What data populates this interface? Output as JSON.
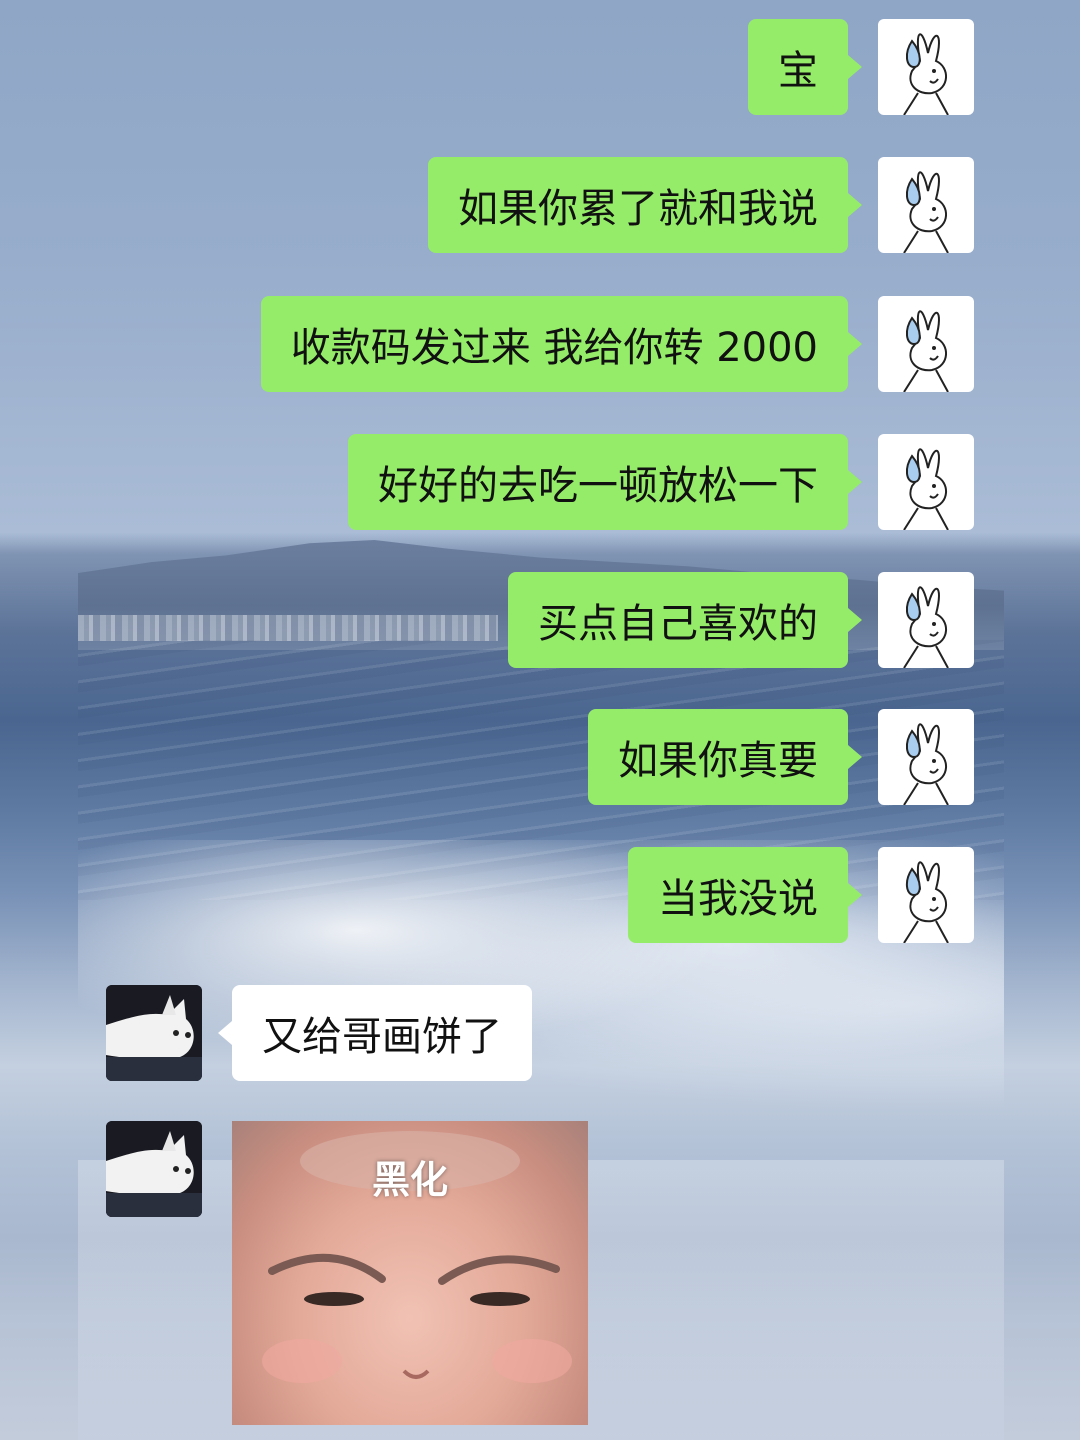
{
  "messages": [
    {
      "sender": "me",
      "text": "宝"
    },
    {
      "sender": "me",
      "text": "如果你累了就和我说"
    },
    {
      "sender": "me",
      "text": "收款码发过来 我给你转 2000"
    },
    {
      "sender": "me",
      "text": "好好的去吃一顿放松一下"
    },
    {
      "sender": "me",
      "text": "买点自己喜欢的"
    },
    {
      "sender": "me",
      "text": "如果你真要"
    },
    {
      "sender": "me",
      "text": "当我没说"
    },
    {
      "sender": "other",
      "text": "又给哥画饼了"
    }
  ],
  "sticker": {
    "caption": "黑化"
  },
  "colors": {
    "outgoing_bubble": "#95ec69",
    "incoming_bubble": "#ffffff"
  },
  "avatars": {
    "me": "bunny-sweat-drop-icon",
    "other": "white-cat-icon"
  }
}
